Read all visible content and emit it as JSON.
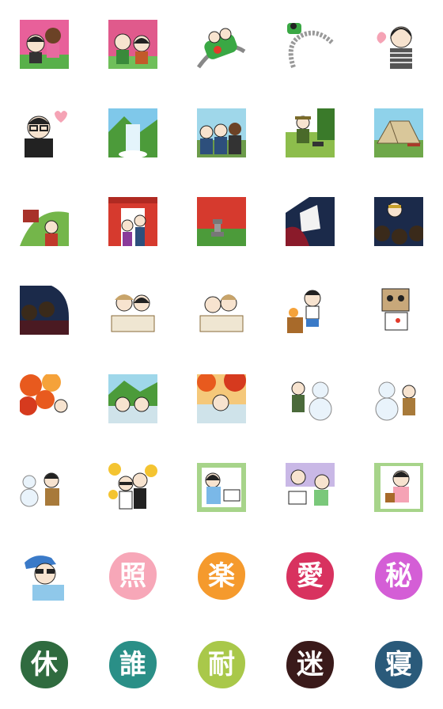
{
  "sticker_sheet": {
    "illustrations": [
      {
        "icon": "couple-pink-icon",
        "bg": "#e8609a"
      },
      {
        "icon": "couple-cheer-icon",
        "bg": "#e05a8c"
      },
      {
        "icon": "rollercoaster-icon",
        "bg": "#57a64a"
      },
      {
        "icon": "rollercoaster-track-icon",
        "bg": "#ffffff"
      },
      {
        "icon": "girl-bob-hair-icon",
        "bg": "#ffffff"
      },
      {
        "icon": "man-glasses-heart-icon",
        "bg": "#ffffff"
      },
      {
        "icon": "waterfall-icon",
        "bg": "#7fc8ea"
      },
      {
        "icon": "group-photo-icon",
        "bg": "#9fd7ea"
      },
      {
        "icon": "camping-bbq-icon",
        "bg": "#8dbd4c"
      },
      {
        "icon": "tent-icon",
        "bg": "#8fd2ea"
      },
      {
        "icon": "shrine-hill-icon",
        "bg": "#74b64a"
      },
      {
        "icon": "torii-crowd-icon",
        "bg": "#d63a2e"
      },
      {
        "icon": "torii-lantern-icon",
        "bg": "#d63a2e"
      },
      {
        "icon": "concert-stage-icon",
        "bg": "#1b2a4a"
      },
      {
        "icon": "concert-crowd-icon",
        "bg": "#1b2a4a"
      },
      {
        "icon": "audience-dark-icon",
        "bg": "#2b2230"
      },
      {
        "icon": "onsen-pair-icon",
        "bg": "#efe6d2"
      },
      {
        "icon": "onsen-steam-icon",
        "bg": "#efe6d2"
      },
      {
        "icon": "bbq-man-icon",
        "bg": "#ffffff"
      },
      {
        "icon": "box-head-robot-icon",
        "bg": "#ffffff"
      },
      {
        "icon": "autumn-leaves-icon",
        "bg": "#e85a1e"
      },
      {
        "icon": "onsen-mountain-icon",
        "bg": "#9fd7ea"
      },
      {
        "icon": "autumn-onsen-icon",
        "bg": "#e85a1e"
      },
      {
        "icon": "snowman-icon",
        "bg": "#e9f3fb"
      },
      {
        "icon": "snowman-pair-icon",
        "bg": "#e9f3fb"
      },
      {
        "icon": "snow-kid-icon",
        "bg": "#ffffff"
      },
      {
        "icon": "sunflower-couple-icon",
        "bg": "#f4c431"
      },
      {
        "icon": "window-sleep-icon",
        "bg": "#a7d48a"
      },
      {
        "icon": "pillow-fight-icon",
        "bg": "#c9b8e6"
      },
      {
        "icon": "gift-girl-icon",
        "bg": "#a7d48a"
      },
      {
        "icon": "man-sunglasses-cap-icon",
        "bg": "#ffffff"
      }
    ],
    "kanji_stamps": [
      {
        "char": "照",
        "color": "#f7a7b8"
      },
      {
        "char": "楽",
        "color": "#f59a2d"
      },
      {
        "char": "愛",
        "color": "#d8325f"
      },
      {
        "char": "秘",
        "color": "#d45ed6"
      },
      {
        "char": "休",
        "color": "#2f6b3f"
      },
      {
        "char": "誰",
        "color": "#2a8f87"
      },
      {
        "char": "耐",
        "color": "#a9c84a"
      },
      {
        "char": "迷",
        "color": "#3a1a1a"
      },
      {
        "char": "寝",
        "color": "#2a5a7a"
      }
    ]
  }
}
